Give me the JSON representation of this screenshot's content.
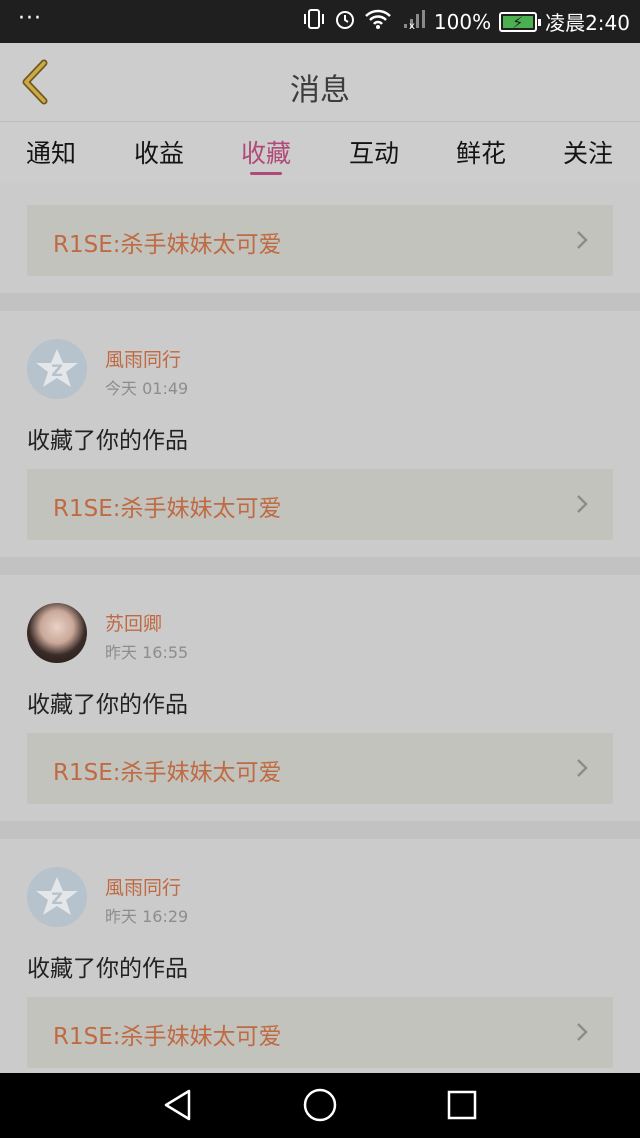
{
  "status_bar": {
    "dots": "···",
    "battery_text": "100%",
    "time": "凌晨2:40"
  },
  "header": {
    "title": "消息"
  },
  "tabs": [
    {
      "label": "通知"
    },
    {
      "label": "收益"
    },
    {
      "label": "收藏",
      "active": true
    },
    {
      "label": "互动"
    },
    {
      "label": "鲜花"
    },
    {
      "label": "关注"
    }
  ],
  "top_item": {
    "work_title": "R1SE:杀手妹妹太可爱"
  },
  "items": [
    {
      "username": "風雨同行",
      "time": "今天 01:49",
      "action": "收藏了你的作品",
      "work_title": "R1SE:杀手妹妹太可爱",
      "avatar": "default-avatar-icon"
    },
    {
      "username": "苏回卿",
      "time": "昨天 16:55",
      "action": "收藏了你的作品",
      "work_title": "R1SE:杀手妹妹太可爱",
      "avatar": "photo"
    },
    {
      "username": "風雨同行",
      "time": "昨天 16:29",
      "action": "收藏了你的作品",
      "work_title": "R1SE:杀手妹妹太可爱",
      "avatar": "default-avatar-icon"
    }
  ],
  "colors": {
    "accent": "#b04b77",
    "work_text": "#c06a43"
  }
}
